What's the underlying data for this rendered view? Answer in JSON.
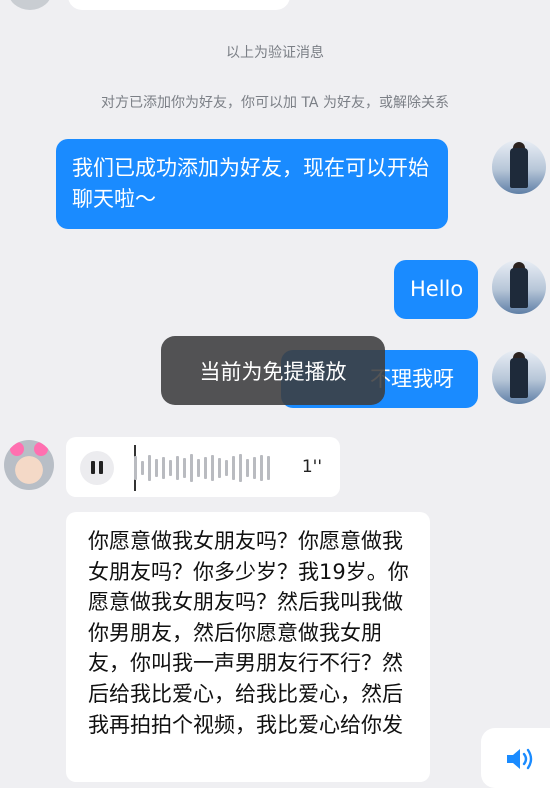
{
  "system": {
    "verify_notice": "以上为验证消息",
    "added_notice": "对方已添加你为好友，你可以加 TA 为好友，或解除关系"
  },
  "messages": {
    "out_1": "我们已成功添加为好友，现在可以开始聊天啦～",
    "out_2": "Hello",
    "out_3": "不理我呀",
    "voice_duration": "1''",
    "in_text": "你愿意做我女朋友吗？你愿意做我女朋友吗？你多少岁？我19岁。你愿意做我女朋友吗？然后我叫我做你男朋友，然后你愿意做我女朋友，你叫我一声男朋友行不行？然后给我比爱心，给我比爱心，然后我再拍拍个视频，我比爱心给你发"
  },
  "toast": {
    "text": "当前为免提播放"
  },
  "icons": {
    "pause": "pause-icon",
    "speaker": "speaker-icon"
  },
  "colors": {
    "bubble_out": "#1a8bff",
    "background": "#efeff2"
  }
}
